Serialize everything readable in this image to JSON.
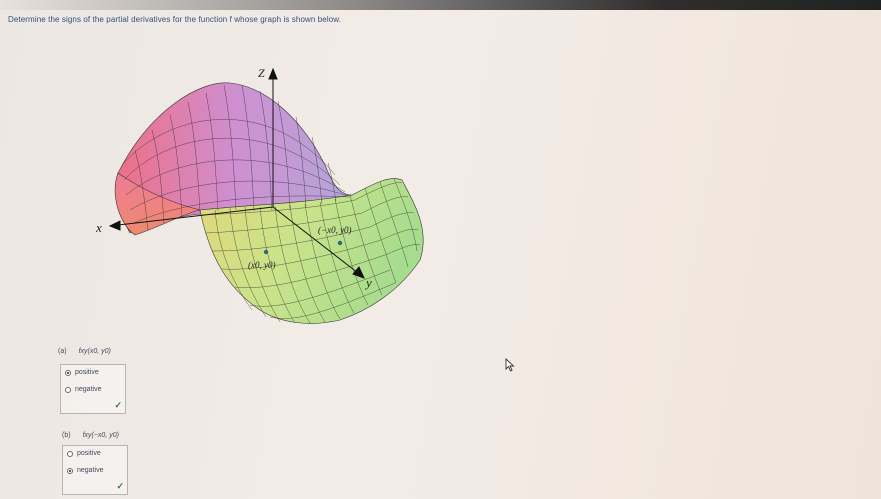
{
  "question": "Determine the signs of the partial derivatives for the function f whose graph is shown below.",
  "figure": {
    "axis_z": "Z",
    "axis_x": "x",
    "axis_y": "y",
    "point_1": "(x0, y0)",
    "point_2": "(−x0, y0)"
  },
  "parts": [
    {
      "letter": "(a)",
      "expr": "fxy(x0, y0)",
      "options": [
        "positive",
        "negative"
      ],
      "selected": "positive",
      "check": "✓"
    },
    {
      "letter": "(b)",
      "expr": "fxy(−x0, y0)",
      "options": [
        "positive",
        "negative"
      ],
      "selected": "negative",
      "check": "✓"
    }
  ]
}
